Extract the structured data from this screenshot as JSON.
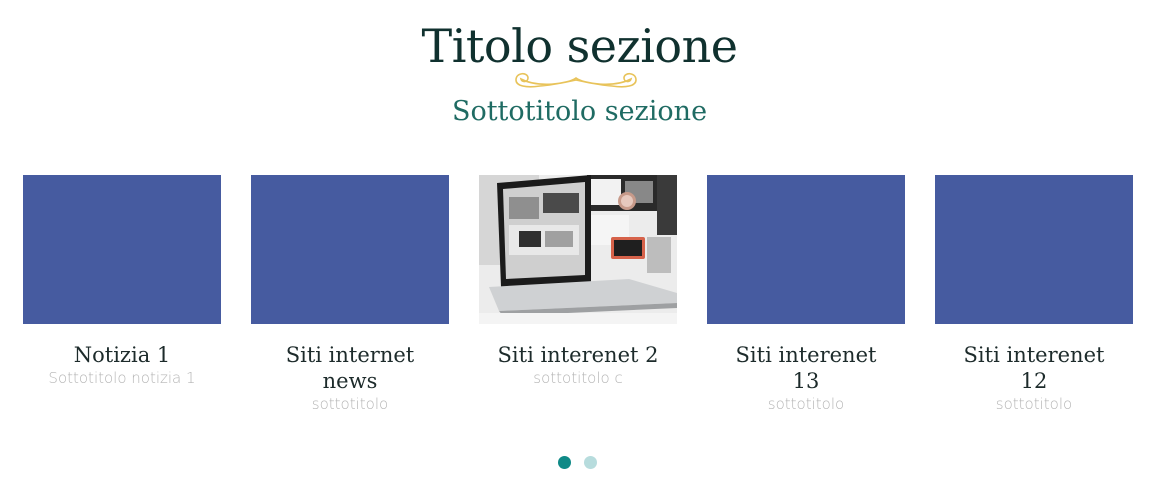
{
  "section": {
    "title": "Titolo sezione",
    "subtitle": "Sottotitolo sezione"
  },
  "cards": [
    {
      "title": "Notizia 1",
      "subtitle": "Sottotitolo notizia 1",
      "image": "placeholder"
    },
    {
      "title": "Siti internet news",
      "subtitle": "sottotitolo",
      "image": "placeholder"
    },
    {
      "title": "Siti interenet 2",
      "subtitle": "sottotitolo c",
      "image": "laptop-workspace-photo"
    },
    {
      "title": "Siti interenet 13",
      "subtitle": "sottotitolo",
      "image": "placeholder"
    },
    {
      "title": "Siti interenet 12",
      "subtitle": "sottotitolo",
      "image": "placeholder"
    }
  ],
  "carousel": {
    "page_count": 2,
    "active_page": 1
  },
  "colors": {
    "title": "#10312f",
    "subtitle": "#1f6b63",
    "ornament": "#e8c35a",
    "placeholder": "#465ba0",
    "dot_active": "#0f8a87",
    "dot_inactive": "#b7dcdd"
  }
}
